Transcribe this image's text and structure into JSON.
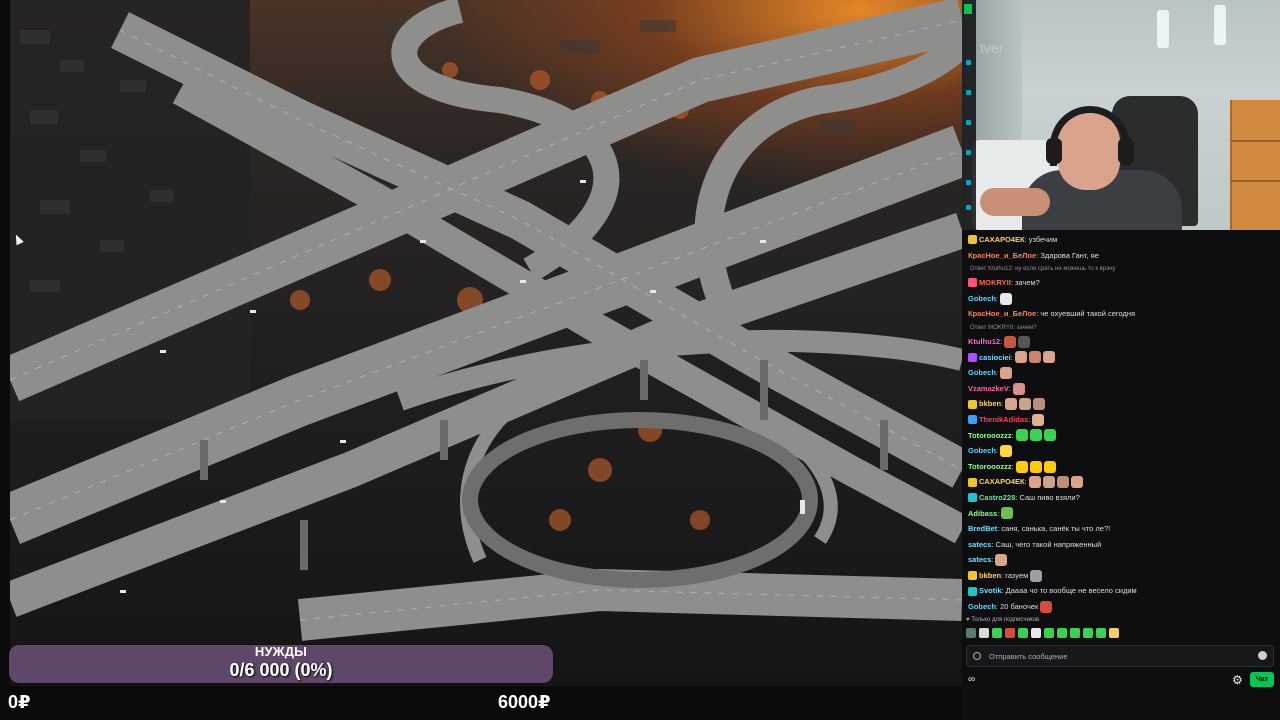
{
  "stream": {
    "goal": {
      "title": "НУЖДЫ",
      "progress_text": "0/6 000 (0%)",
      "fraction": 0.0
    },
    "min_amount": "0₽",
    "max_amount": "6000₽"
  },
  "webcam": {
    "overlay_text": "tver"
  },
  "chat": {
    "messages": [
      {
        "user": "САХАРО4ЕК",
        "color": "#ffd54a",
        "badge": "#f0c42f",
        "text": ": узбечим",
        "emotes": []
      },
      {
        "user": "КрасНое_и_БеЛое",
        "color": "#ff7f50",
        "text": ": Здарова Гант, яе",
        "emotes": []
      },
      {
        "reply": "Ответ Ktulhu12: ну если срать не можешь то к врачу"
      },
      {
        "user": "MOKRYII",
        "color": "#ff6a3d",
        "badge": "#ff4f7b",
        "text": ": зачем?",
        "emotes": []
      },
      {
        "user": "Gobech",
        "color": "#57d7ff",
        "text": ": ",
        "emotes": [
          "#e8e8e8"
        ]
      },
      {
        "user": "КрасНое_и_БеЛое",
        "color": "#ff7f50",
        "text": ": че охуевший такой сегодня",
        "emotes": []
      },
      {
        "reply": "Ответ MOKRYII: зачем?"
      },
      {
        "user": "Ktulhu12",
        "color": "#ff66cc",
        "text": ": ",
        "emotes": [
          "#c9563c",
          "#555555"
        ]
      },
      {
        "user": "casiociei",
        "color": "#66e0ff",
        "badge": "#b14fff",
        "text": ": ",
        "emotes": [
          "#d9a48b",
          "#c9826b",
          "#d9a48b"
        ]
      },
      {
        "user": "Gobech",
        "color": "#57d7ff",
        "text": ": ",
        "emotes": [
          "#d9a48b"
        ]
      },
      {
        "user": "VzamazkeV",
        "color": "#ff5ea8",
        "text": ": ",
        "emotes": [
          "#d98f8f"
        ]
      },
      {
        "user": "bkben",
        "color": "#ffd54a",
        "badge": "#f0c42f",
        "text": ": ",
        "emotes": [
          "#d9a48b",
          "#c9a48b",
          "#b98f7a"
        ]
      },
      {
        "user": "ThenikAdidas",
        "color": "#ff3d5a",
        "badge": "#3aa0ff",
        "text": ": ",
        "emotes": [
          "#e0b08f"
        ]
      },
      {
        "user": "Totorooozzz",
        "color": "#8cff8c",
        "text": ": ",
        "emotes": [
          "#39d353",
          "#39d353",
          "#39d353"
        ]
      },
      {
        "user": "Gobech",
        "color": "#57d7ff",
        "text": ": ",
        "emotes": [
          "#ffd83d"
        ]
      },
      {
        "user": "Totorooozzz",
        "color": "#8cff8c",
        "text": ": ",
        "emotes": [
          "#ffcc00",
          "#ffcc00",
          "#ffcc00"
        ]
      },
      {
        "user": "САХАРО4ЕК",
        "color": "#ffd54a",
        "badge": "#f0c42f",
        "text": ": ",
        "emotes": [
          "#d9a48b",
          "#c9a48b",
          "#b98f7a",
          "#d9a48b"
        ]
      },
      {
        "user": "Castro228",
        "color": "#5ee8a0",
        "badge": "#1ec8c8",
        "text": ": Саш пиво взяли?",
        "emotes": []
      },
      {
        "user": "Adibass",
        "color": "#8cff8c",
        "text": ": ",
        "emotes": [
          "#6fbf4a"
        ]
      },
      {
        "user": "BredBet",
        "color": "#66e0ff",
        "text": ": саня, санька, санёк ты что ле?!",
        "emotes": []
      },
      {
        "user": "satecs",
        "color": "#66e0ff",
        "text": ": Саш, чего такой напряженный",
        "emotes": []
      },
      {
        "user": "satecs",
        "color": "#66e0ff",
        "text": ": ",
        "emotes": [
          "#d9a48b"
        ]
      },
      {
        "user": "bkben",
        "color": "#ffd54a",
        "badge": "#f0c42f",
        "text": ": газуем",
        "emotes": [
          "#9aa0a6"
        ]
      },
      {
        "user": "Svotik",
        "color": "#66e0ff",
        "badge": "#1ec8c8",
        "text": ": Даааа чо то вообще не весело сидим",
        "emotes": []
      },
      {
        "user": "Gobech",
        "color": "#57d7ff",
        "text": ": 20 баночек",
        "emotes": [
          "#d94a3c"
        ]
      }
    ],
    "subs_only_text": "Только для подписчиков",
    "emote_row": [
      "#5a7d6a",
      "#d9d9d9",
      "#39d353",
      "#d94a3c",
      "#39d353",
      "#e8e8e8",
      "#39d353",
      "#39d353",
      "#39d353",
      "#39d353",
      "#39d353",
      "#ffcc66"
    ],
    "input_placeholder": "Отправить сообщение",
    "points_icon": "∞",
    "chat_button_label": "Чат"
  }
}
